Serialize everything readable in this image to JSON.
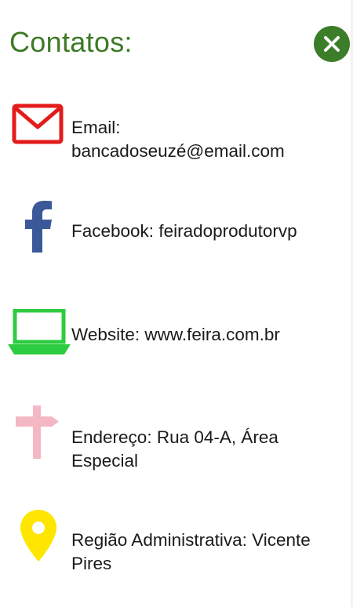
{
  "header": {
    "title": "Contatos:",
    "close_icon": "close-circle-icon"
  },
  "colors": {
    "title": "#3d7a25",
    "close_button": "#3b7d28",
    "email_icon": "#e31b1b",
    "facebook_icon": "#3b5998",
    "website_icon": "#2ecc40",
    "address_icon": "#f4b8c4",
    "region_icon": "#ffe600"
  },
  "contacts": [
    {
      "icon": "envelope-icon",
      "line1": "Email:",
      "line2": "bancadoseuzé@email.com"
    },
    {
      "icon": "facebook-icon",
      "line1": "Facebook: feiradoprodutorvp",
      "line2": ""
    },
    {
      "icon": "laptop-icon",
      "line1": "Website: www.feira.com.br",
      "line2": ""
    },
    {
      "icon": "signpost-icon",
      "line1": "Endereço: Rua 04-A, Área",
      "line2": "Especial"
    },
    {
      "icon": "map-pin-icon",
      "line1": "Região Administrativa: Vicente",
      "line2": "Pires"
    }
  ]
}
